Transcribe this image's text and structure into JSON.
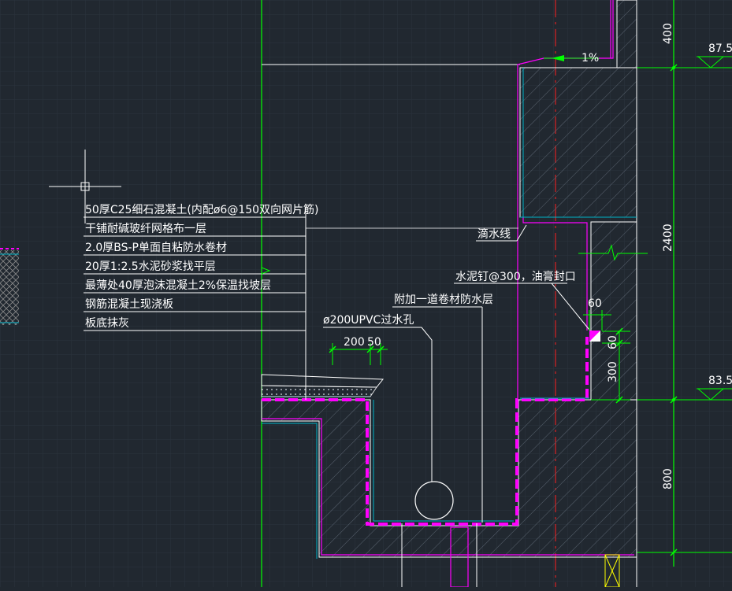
{
  "colors": {
    "background": "#212830",
    "grid": "#2f3945",
    "green": "#00ff00",
    "magenta": "#ff00ff",
    "cyan": "#00b4c8",
    "white": "#ffffff",
    "red": "#ff2020",
    "hatch": "#5a6470"
  },
  "layers": {
    "lines": [
      "50厚C25细石混凝土(内配ø6@150双向网片筋)",
      "干铺耐碱玻纤网格布一层",
      "2.0厚BS-P单面自粘防水卷材",
      "20厚1:2.5水泥砂浆找平层",
      "最薄处40厚泡沫混凝土2%保温找坡层",
      "钢筋混凝土现浇板",
      "板底抹灰"
    ]
  },
  "labels": {
    "slope": "1%",
    "drip": "滴水线",
    "nail": "水泥钉@300，油膏封口",
    "extra_membrane": "附加一道卷材防水层",
    "pipe": "ø200UPVC过水孔"
  },
  "dims": {
    "d200": "200",
    "d50": "50",
    "d60h": "60",
    "d60v": "60",
    "d300": "300",
    "d400": "400",
    "d2400": "2400",
    "d800": "800"
  },
  "levels": {
    "top": "87.5",
    "mid": "83.5"
  }
}
